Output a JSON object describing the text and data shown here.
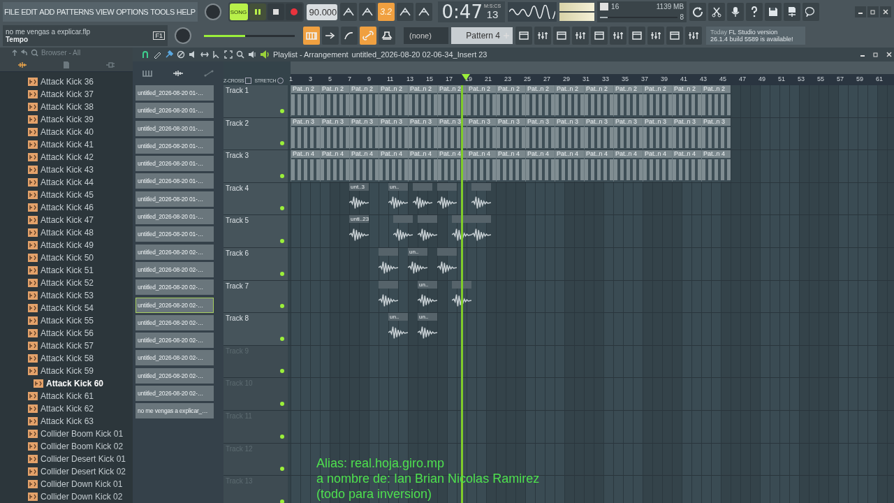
{
  "menu": [
    "FILE",
    "EDIT",
    "ADD",
    "PATTERNS",
    "VIEW",
    "OPTIONS",
    "TOOLS",
    "HELP"
  ],
  "transport": {
    "mode": "SONG",
    "song_selected": true,
    "playing": true
  },
  "tempo": "90.000",
  "snap": "3.2",
  "time": {
    "value": "0:47",
    "sub": "13",
    "unit": "M:S:CS"
  },
  "cpu": {
    "polyphony": "16",
    "memory": "1139 MB",
    "voices": "8",
    "level": 0.1
  },
  "project": {
    "file": "no me vengas a explicar.flp",
    "hint": "Tempo",
    "key": "F1"
  },
  "master_volume": {
    "level": 0.45
  },
  "toolbar_top": [
    {
      "on": false
    },
    {
      "on": false
    },
    {
      "on": true
    },
    {
      "on": false
    },
    {
      "on": false
    }
  ],
  "toolbar_bottom": [
    {
      "on": true
    },
    {
      "on": false
    },
    {
      "on": false
    },
    {
      "on": true
    },
    {
      "on": false
    }
  ],
  "pattern_picker": {
    "none": "(none)",
    "pattern": "Pattern 4"
  },
  "news": {
    "title": "Today",
    "line1": "FL Studio version",
    "line2": "26.1.4 build 5589 is available!"
  },
  "browser": {
    "title": "Browser - All",
    "items": [
      {
        "label": "Attack Kick 36",
        "selected": false
      },
      {
        "label": "Attack Kick 37",
        "selected": false
      },
      {
        "label": "Attack Kick 38",
        "selected": false
      },
      {
        "label": "Attack Kick 39",
        "selected": false
      },
      {
        "label": "Attack Kick 40",
        "selected": false
      },
      {
        "label": "Attack Kick 41",
        "selected": false
      },
      {
        "label": "Attack Kick 42",
        "selected": false
      },
      {
        "label": "Attack Kick 43",
        "selected": false
      },
      {
        "label": "Attack Kick 44",
        "selected": false
      },
      {
        "label": "Attack Kick 45",
        "selected": false
      },
      {
        "label": "Attack Kick 46",
        "selected": false
      },
      {
        "label": "Attack Kick 47",
        "selected": false
      },
      {
        "label": "Attack Kick 48",
        "selected": false
      },
      {
        "label": "Attack Kick 49",
        "selected": false
      },
      {
        "label": "Attack Kick 50",
        "selected": false
      },
      {
        "label": "Attack Kick 51",
        "selected": false
      },
      {
        "label": "Attack Kick 52",
        "selected": false
      },
      {
        "label": "Attack Kick 53",
        "selected": false
      },
      {
        "label": "Attack Kick 54",
        "selected": false
      },
      {
        "label": "Attack Kick 55",
        "selected": false
      },
      {
        "label": "Attack Kick 56",
        "selected": false
      },
      {
        "label": "Attack Kick 57",
        "selected": false
      },
      {
        "label": "Attack Kick 58",
        "selected": false
      },
      {
        "label": "Attack Kick 59",
        "selected": false
      },
      {
        "label": "Attack Kick 60",
        "selected": true
      },
      {
        "label": "Attack Kick 61",
        "selected": false
      },
      {
        "label": "Attack Kick 62",
        "selected": false
      },
      {
        "label": "Attack Kick 63",
        "selected": false
      },
      {
        "label": "Collider Boom Kick 01",
        "selected": false
      },
      {
        "label": "Collider Boom Kick 02",
        "selected": false
      },
      {
        "label": "Collider Desert Kick 01",
        "selected": false
      },
      {
        "label": "Collider Desert Kick 02",
        "selected": false
      },
      {
        "label": "Collider Down Kick 01",
        "selected": false
      },
      {
        "label": "Collider Down Kick 02",
        "selected": false
      }
    ]
  },
  "playlist": {
    "title": "Playlist - Arrangement",
    "path": "untitled_2026-08-20 02-06-34_Insert 23",
    "zcross": "Z-CROSS",
    "stretch": "STRETCH",
    "clip_list": [
      {
        "label": "untitled_2026-08-20 01-…",
        "selected": false
      },
      {
        "label": "untitled_2026-08-20 01-…",
        "selected": false
      },
      {
        "label": "untitled_2026-08-20 01-…",
        "selected": false
      },
      {
        "label": "untitled_2026-08-20 01-…",
        "selected": false
      },
      {
        "label": "untitled_2026-08-20 01-…",
        "selected": false
      },
      {
        "label": "untitled_2026-08-20 01-…",
        "selected": false
      },
      {
        "label": "untitled_2026-08-20 01-…",
        "selected": false
      },
      {
        "label": "untitled_2026-08-20 01-…",
        "selected": false
      },
      {
        "label": "untitled_2026-08-20 01-…",
        "selected": false
      },
      {
        "label": "untitled_2026-08-20 02-…",
        "selected": false
      },
      {
        "label": "untitled_2026-08-20 02-…",
        "selected": false
      },
      {
        "label": "untitled_2026-08-20 02-…",
        "selected": false
      },
      {
        "label": "untitled_2026-08-20 02-…",
        "selected": true
      },
      {
        "label": "untitled_2026-08-20 02-…",
        "selected": false
      },
      {
        "label": "untitled_2026-08-20 02-…",
        "selected": false
      },
      {
        "label": "untitled_2026-08-20 02-…",
        "selected": false
      },
      {
        "label": "untitled_2026-08-20 02-…",
        "selected": false
      },
      {
        "label": "untitled_2026-08-20 02-…",
        "selected": false
      },
      {
        "label": "no me vengas a explicar_…",
        "selected": false
      }
    ],
    "ruler": [
      "1",
      "3",
      "5",
      "7",
      "9",
      "11",
      "13",
      "15",
      "17",
      "19",
      "21",
      "23",
      "25",
      "27",
      "29",
      "31",
      "33",
      "35",
      "37",
      "39",
      "41",
      "43",
      "45",
      "47",
      "49",
      "51",
      "53",
      "55",
      "57",
      "59",
      "61"
    ],
    "playhead": {
      "level": 0.29
    },
    "tracks": [
      {
        "name": "Track 1",
        "empty": false,
        "clips": [
          {
            "kind": "pattern",
            "label": "Pat..n 2"
          },
          {
            "kind": "pattern",
            "label": "Pat..n 2"
          },
          {
            "kind": "pattern",
            "label": "Pat..n 2"
          },
          {
            "kind": "pattern",
            "label": "Pat..n 2"
          },
          {
            "kind": "pattern",
            "label": "Pat..n 2"
          },
          {
            "kind": "pattern",
            "label": "Pat..n 2"
          },
          {
            "kind": "pattern",
            "label": "Pat..n 2"
          },
          {
            "kind": "pattern",
            "label": "Pat..n 2"
          },
          {
            "kind": "pattern",
            "label": "Pat..n 2"
          },
          {
            "kind": "pattern",
            "label": "Pat..n 2"
          },
          {
            "kind": "pattern",
            "label": "Pat..n 2"
          },
          {
            "kind": "pattern",
            "label": "Pat..n 2"
          },
          {
            "kind": "pattern",
            "label": "Pat..n 2"
          },
          {
            "kind": "pattern",
            "label": "Pat..n 2"
          },
          {
            "kind": "pattern",
            "label": "Pat..n 2"
          }
        ]
      },
      {
        "name": "Track 2",
        "empty": false,
        "clips": [
          {
            "kind": "pattern",
            "label": "Pat..n 3"
          },
          {
            "kind": "pattern",
            "label": "Pat..n 3"
          },
          {
            "kind": "pattern",
            "label": "Pat..n 3"
          },
          {
            "kind": "pattern",
            "label": "Pat..n 3"
          },
          {
            "kind": "pattern",
            "label": "Pat..n 3"
          },
          {
            "kind": "pattern",
            "label": "Pat..n 3"
          },
          {
            "kind": "pattern",
            "label": "Pat..n 3"
          },
          {
            "kind": "pattern",
            "label": "Pat..n 3"
          },
          {
            "kind": "pattern",
            "label": "Pat..n 3"
          },
          {
            "kind": "pattern",
            "label": "Pat..n 3"
          },
          {
            "kind": "pattern",
            "label": "Pat..n 3"
          },
          {
            "kind": "pattern",
            "label": "Pat..n 3"
          },
          {
            "kind": "pattern",
            "label": "Pat..n 3"
          },
          {
            "kind": "pattern",
            "label": "Pat..n 3"
          },
          {
            "kind": "pattern",
            "label": "Pat..n 3"
          }
        ]
      },
      {
        "name": "Track 3",
        "empty": false,
        "clips": [
          {
            "kind": "pattern",
            "label": "Pat..n 4"
          },
          {
            "kind": "pattern",
            "label": "Pat..n 4"
          },
          {
            "kind": "pattern",
            "label": "Pat..n 4"
          },
          {
            "kind": "pattern",
            "label": "Pat..n 4"
          },
          {
            "kind": "pattern",
            "label": "Pat..n 4"
          },
          {
            "kind": "pattern",
            "label": "Pat..n 4"
          },
          {
            "kind": "pattern",
            "label": "Pat..n 4"
          },
          {
            "kind": "pattern",
            "label": "Pat..n 4"
          },
          {
            "kind": "pattern",
            "label": "Pat..n 4"
          },
          {
            "kind": "pattern",
            "label": "Pat..n 4"
          },
          {
            "kind": "pattern",
            "label": "Pat..n 4"
          },
          {
            "kind": "pattern",
            "label": "Pat..n 4"
          },
          {
            "kind": "pattern",
            "label": "Pat..n 4"
          },
          {
            "kind": "pattern",
            "label": "Pat..n 4"
          },
          {
            "kind": "pattern",
            "label": "Pat..n 4"
          }
        ]
      },
      {
        "name": "Track 4",
        "empty": false,
        "clips": [
          {
            "kind": "rest"
          },
          {
            "kind": "rest"
          },
          {
            "kind": "rest"
          },
          {
            "kind": "rest"
          },
          {
            "kind": "rest"
          },
          {
            "kind": "rest"
          },
          {
            "kind": "audio",
            "label": "unt..3"
          },
          {
            "kind": "rest"
          },
          {
            "kind": "rest"
          },
          {
            "kind": "audio",
            "label": "un.."
          },
          {
            "kind": "half_rest"
          },
          {
            "kind": "audio"
          },
          {
            "kind": "half_rest"
          },
          {
            "kind": "audio"
          },
          {
            "kind": "rest"
          },
          {
            "kind": "half_rest"
          },
          {
            "kind": "audio"
          }
        ]
      },
      {
        "name": "Track 5",
        "empty": false,
        "clips": [
          {
            "kind": "rest"
          },
          {
            "kind": "rest"
          },
          {
            "kind": "rest"
          },
          {
            "kind": "rest"
          },
          {
            "kind": "rest"
          },
          {
            "kind": "rest"
          },
          {
            "kind": "audio",
            "label": "unti..23"
          },
          {
            "kind": "rest"
          },
          {
            "kind": "rest"
          },
          {
            "kind": "half_rest"
          },
          {
            "kind": "audio"
          },
          {
            "kind": "half_rest"
          },
          {
            "kind": "audio"
          },
          {
            "kind": "rest"
          },
          {
            "kind": "half_rest"
          },
          {
            "kind": "audio"
          },
          {
            "kind": "audio"
          }
        ]
      },
      {
        "name": "Track 6",
        "empty": false,
        "clips": [
          {
            "kind": "rest"
          },
          {
            "kind": "rest"
          },
          {
            "kind": "rest"
          },
          {
            "kind": "rest"
          },
          {
            "kind": "rest"
          },
          {
            "kind": "rest"
          },
          {
            "kind": "rest"
          },
          {
            "kind": "rest"
          },
          {
            "kind": "rest"
          },
          {
            "kind": "audio"
          },
          {
            "kind": "rest"
          },
          {
            "kind": "audio",
            "label": "un.."
          },
          {
            "kind": "rest"
          },
          {
            "kind": "audio"
          }
        ]
      },
      {
        "name": "Track 7",
        "empty": false,
        "clips": [
          {
            "kind": "rest"
          },
          {
            "kind": "rest"
          },
          {
            "kind": "rest"
          },
          {
            "kind": "rest"
          },
          {
            "kind": "rest"
          },
          {
            "kind": "rest"
          },
          {
            "kind": "rest"
          },
          {
            "kind": "rest"
          },
          {
            "kind": "rest"
          },
          {
            "kind": "audio"
          },
          {
            "kind": "rest"
          },
          {
            "kind": "rest"
          },
          {
            "kind": "audio",
            "label": "un.."
          },
          {
            "kind": "rest"
          },
          {
            "kind": "half_rest"
          },
          {
            "kind": "audio"
          }
        ]
      },
      {
        "name": "Track 8",
        "empty": false,
        "clips": [
          {
            "kind": "rest"
          },
          {
            "kind": "rest"
          },
          {
            "kind": "rest"
          },
          {
            "kind": "rest"
          },
          {
            "kind": "rest"
          },
          {
            "kind": "rest"
          },
          {
            "kind": "rest"
          },
          {
            "kind": "rest"
          },
          {
            "kind": "rest"
          },
          {
            "kind": "rest"
          },
          {
            "kind": "audio",
            "label": "un.."
          },
          {
            "kind": "rest"
          },
          {
            "kind": "audio",
            "label": "un.."
          }
        ]
      },
      {
        "name": "Track 9",
        "empty": true
      },
      {
        "name": "Track 10",
        "empty": true
      },
      {
        "name": "Track 11",
        "empty": true
      },
      {
        "name": "Track 12",
        "empty": true
      },
      {
        "name": "Track 13",
        "empty": true
      }
    ]
  },
  "overlay_text": [
    "Alias: real.hoja.giro.mp",
    "a nombre de: Ian Brian Nicolas Ramirez",
    "(todo para inversion)"
  ]
}
